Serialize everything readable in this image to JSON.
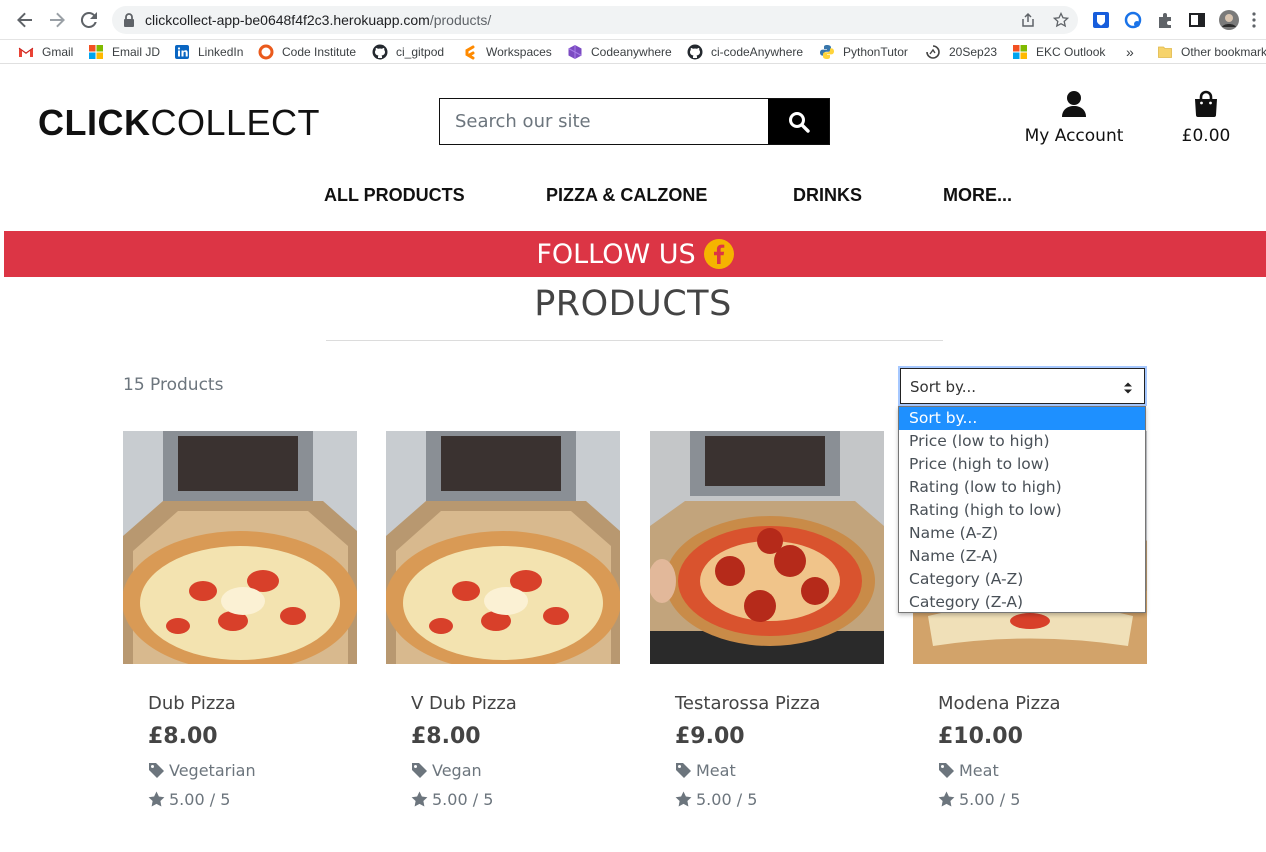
{
  "browser": {
    "url_host": "clickcollect-app-be0648f4f2c3.herokuapp.com",
    "url_path": "/products/",
    "bookmarks": [
      "Gmail",
      "Email JD",
      "LinkedIn",
      "Code Institute",
      "ci_gitpod",
      "Workspaces",
      "Codeanywhere",
      "ci-codeAnywhere",
      "PythonTutor",
      "20Sep23",
      "EKC Outlook",
      "Other bookmarks"
    ],
    "more_bookmarks": "»"
  },
  "header": {
    "logo_bold": "CLICK",
    "logo_light": "COLLECT",
    "search_placeholder": "Search our site",
    "account_label": "My Account",
    "bag_total": "£0.00"
  },
  "nav": [
    "ALL PRODUCTS",
    "PIZZA & CALZONE",
    "DRINKS",
    "MORE..."
  ],
  "banner": {
    "text": "FOLLOW US"
  },
  "page": {
    "title": "PRODUCTS",
    "count": "15 Products",
    "sort_value": "Sort by...",
    "sort_options": [
      "Sort by...",
      "Price (low to high)",
      "Price (high to low)",
      "Rating (low to high)",
      "Rating (high to low)",
      "Name (A-Z)",
      "Name (Z-A)",
      "Category (A-Z)",
      "Category (Z-A)"
    ]
  },
  "products": [
    {
      "name": "Dub Pizza",
      "price": "£8.00",
      "category": "Vegetarian",
      "rating": "5.00 / 5"
    },
    {
      "name": "V Dub Pizza",
      "price": "£8.00",
      "category": "Vegan",
      "rating": "5.00 / 5"
    },
    {
      "name": "Testarossa Pizza",
      "price": "£9.00",
      "category": "Meat",
      "rating": "5.00 / 5"
    },
    {
      "name": "Modena Pizza",
      "price": "£10.00",
      "category": "Meat",
      "rating": "5.00 / 5"
    }
  ],
  "colors": {
    "banner": "#dc3545",
    "facebook": "#f5b400",
    "select_highlight": "#1e90ff",
    "text_muted": "#6c757d"
  }
}
